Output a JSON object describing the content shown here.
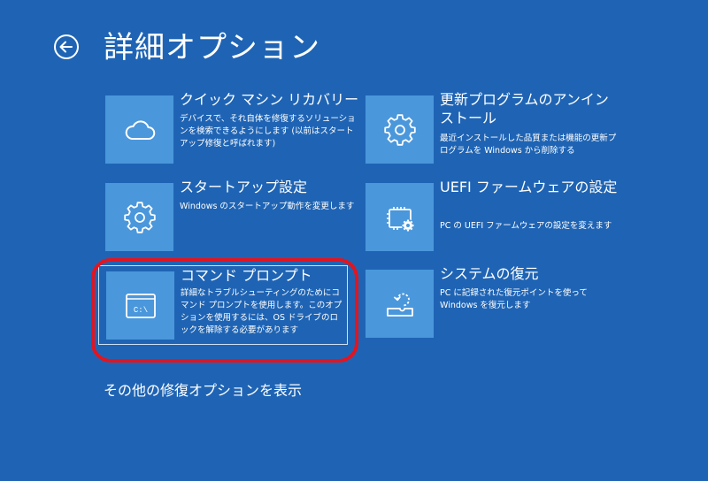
{
  "header": {
    "title": "詳細オプション",
    "back_icon": "arrow-left-circle-icon"
  },
  "options": [
    {
      "title": "クイック マシン リカバリー",
      "description": "デバイスで、それ自体を修復するソリューションを検索できるようにします (以前はスタートアップ修復と呼ばれます)",
      "icon": "cloud-icon"
    },
    {
      "title": "更新プログラムのアンインストール",
      "description": "最近インストールした品質または機能の更新プログラムを Windows から削除する",
      "icon": "gear-icon"
    },
    {
      "title": "スタートアップ設定",
      "description": "Windows のスタートアップ動作を変更します",
      "icon": "gear-icon"
    },
    {
      "title": "UEFI ファームウェアの設定",
      "description": "PC の UEFI ファームウェアの設定を変えます",
      "icon": "chip-gear-icon"
    },
    {
      "title": "コマンド プロンプト",
      "description": "詳細なトラブルシューティングのためにコマンド プロンプトを使用します。このオプションを使用するには、OS ドライブのロックを解除する必要があります",
      "icon": "command-prompt-icon",
      "icon_text": "C:\\"
    },
    {
      "title": "システムの復元",
      "description": "PC に記録された復元ポイントを使って Windows を復元します",
      "icon": "system-restore-icon"
    }
  ],
  "footer": {
    "more_options_label": "その他の修復オプションを表示"
  },
  "colors": {
    "background": "#1f64b4",
    "tile_icon_bg": "#4a97dc",
    "highlight_ring": "#e4141e"
  }
}
